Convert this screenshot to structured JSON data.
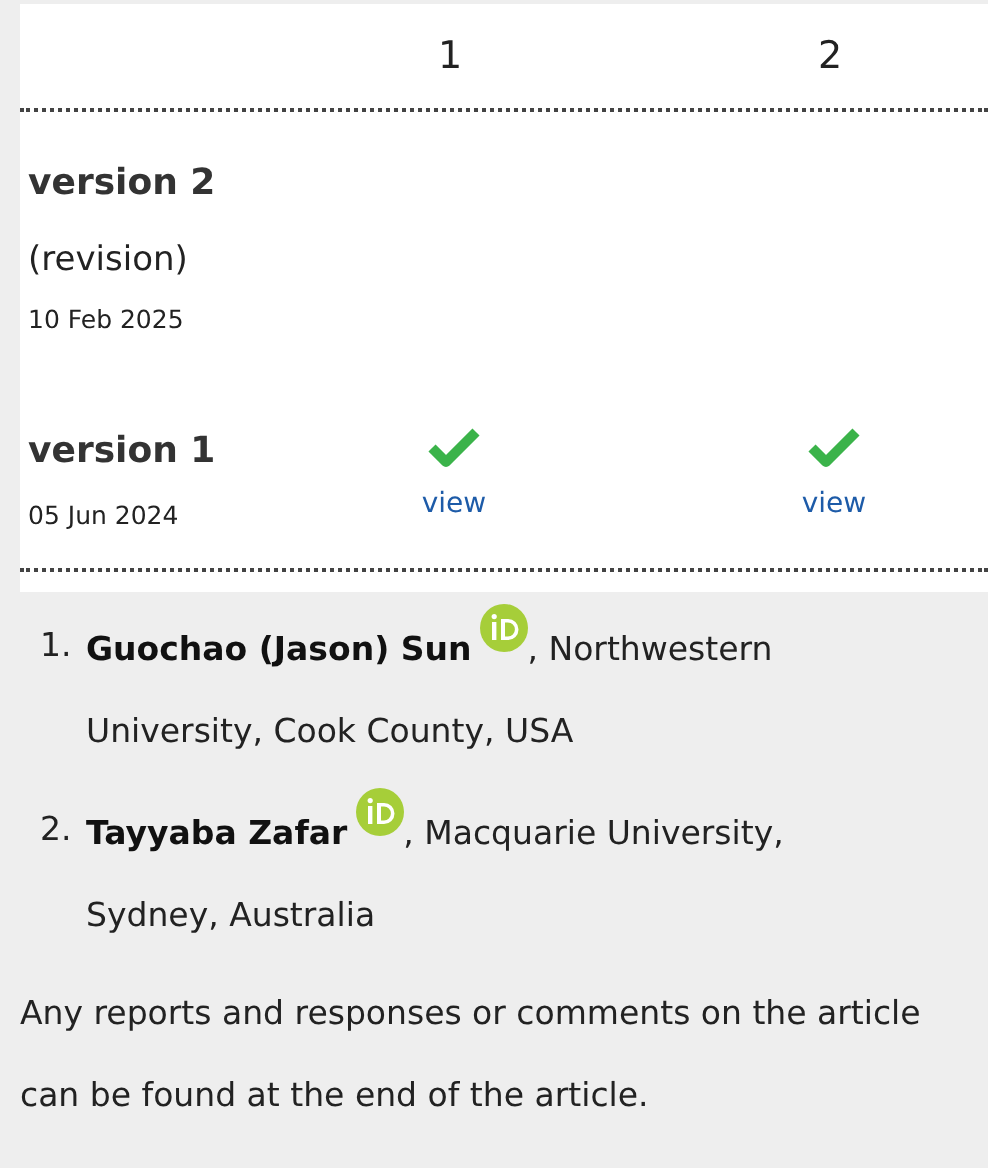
{
  "reviewers": [
    "1",
    "2"
  ],
  "versions": [
    {
      "label": "version 2",
      "note": "(revision)",
      "date": "10 Feb 2025"
    },
    {
      "label": "version 1",
      "date": "05 Jun 2024",
      "reports": [
        {
          "approved": true,
          "link": "view"
        },
        {
          "approved": true,
          "link": "view"
        }
      ]
    }
  ],
  "authors": [
    {
      "number": "1.",
      "name": "Guochao (Jason) Sun",
      "orcid": true,
      "affiliation_lines": [
        ", Northwestern",
        "University, Cook County, USA"
      ]
    },
    {
      "number": "2.",
      "name": "Tayyaba Zafar",
      "orcid": true,
      "affiliation_lines": [
        ", Macquarie University,",
        "Sydney, Australia"
      ]
    }
  ],
  "note": "Any reports and responses or comments on the article can be found at the end of the article."
}
